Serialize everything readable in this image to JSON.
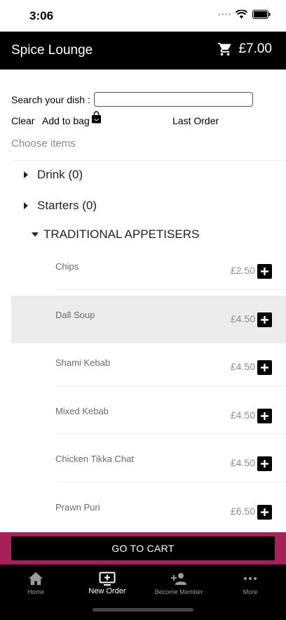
{
  "status_bar": {
    "time": "3:06"
  },
  "header": {
    "title": "Spice Lounge",
    "cart_total": "£7.00"
  },
  "search": {
    "label": "Search your dish :",
    "value": "",
    "placeholder": ""
  },
  "actions": {
    "clear": "Clear",
    "add_to_bag": "Add to bag",
    "last_order": "Last Order"
  },
  "choose_items": "Choose items",
  "categories": [
    {
      "label": "Drink (0)",
      "expanded": false
    },
    {
      "label": "Starters (0)",
      "expanded": false
    },
    {
      "label": "TRADITIONAL APPETISERS",
      "expanded": true
    }
  ],
  "items": [
    {
      "name": "Chips",
      "price": "£2.50"
    },
    {
      "name": "Dall Soup",
      "price": "£4.50"
    },
    {
      "name": "Shami Kebab",
      "price": "£4.50"
    },
    {
      "name": "Mixed Kebab",
      "price": "£4.50"
    },
    {
      "name": "Chicken Tikka Chat",
      "price": "£4.50"
    },
    {
      "name": "Prawn Puri",
      "price": "£6.50"
    }
  ],
  "cart_button": "GO TO CART",
  "tabs": [
    {
      "label": "Home",
      "icon": "home-icon"
    },
    {
      "label": "New Order",
      "icon": "new-order-icon",
      "active": true
    },
    {
      "label": "Become Member",
      "icon": "add-person-icon"
    },
    {
      "label": "More",
      "icon": "more-icon"
    }
  ],
  "colors": {
    "header": "#000000",
    "cart_bar": "#a8205a",
    "highlight_row": "#ececec"
  }
}
